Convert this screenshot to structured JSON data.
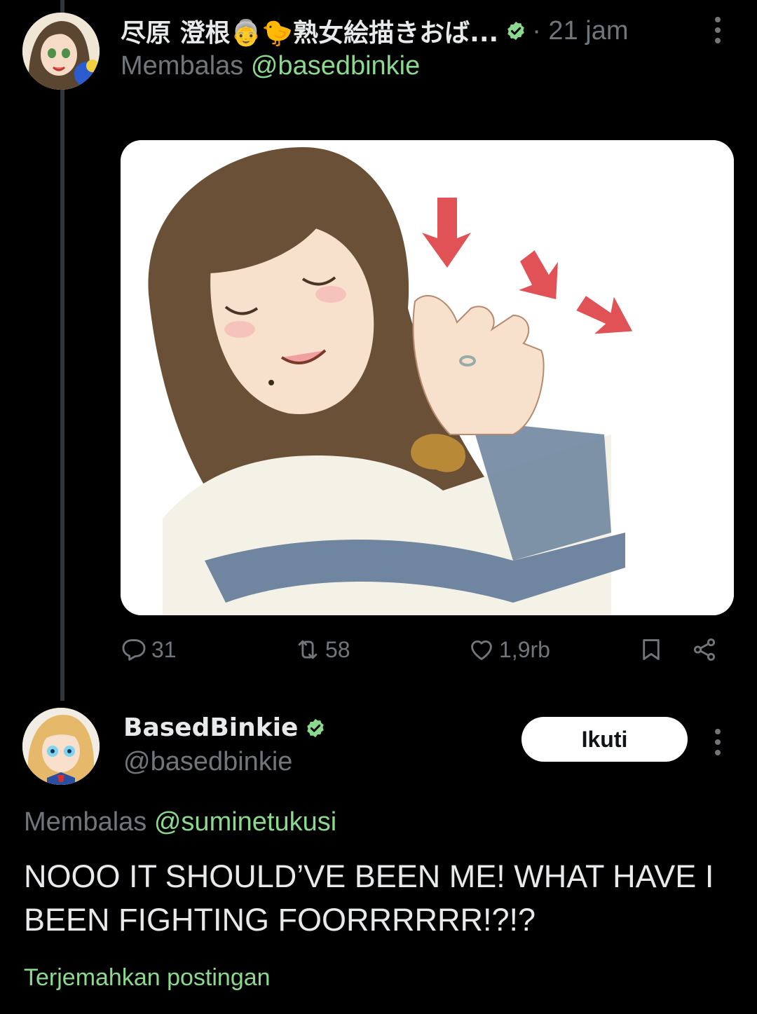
{
  "theme": {
    "background": "#000000",
    "text": "#e7e9ea",
    "muted": "#71767b",
    "accent": "#8bd88f",
    "verified": "#8bd88f"
  },
  "tweet1": {
    "display_name": "尽原 澄根👵🐤熟女絵描きおば...",
    "time": "· 21 jam",
    "reply_prefix": "Membalas",
    "reply_handle": "@basedbinkie",
    "media_icon": "anime-illustration-waving-woman",
    "actions": {
      "reply_count": "31",
      "retweet_count": "58",
      "like_count": "1,9rb"
    }
  },
  "tweet2": {
    "display_name": "BasedBinkie",
    "handle": "@basedbinkie",
    "follow_label": "Ikuti",
    "reply_prefix": "Membalas",
    "reply_handle": "@suminetukusi",
    "text": "NOOO IT SHOULD’VE BEEN ME! WHAT HAVE I BEEN FIGHTING FOORRRRRR!?!?",
    "translate_label": "Terjemahkan postingan"
  }
}
